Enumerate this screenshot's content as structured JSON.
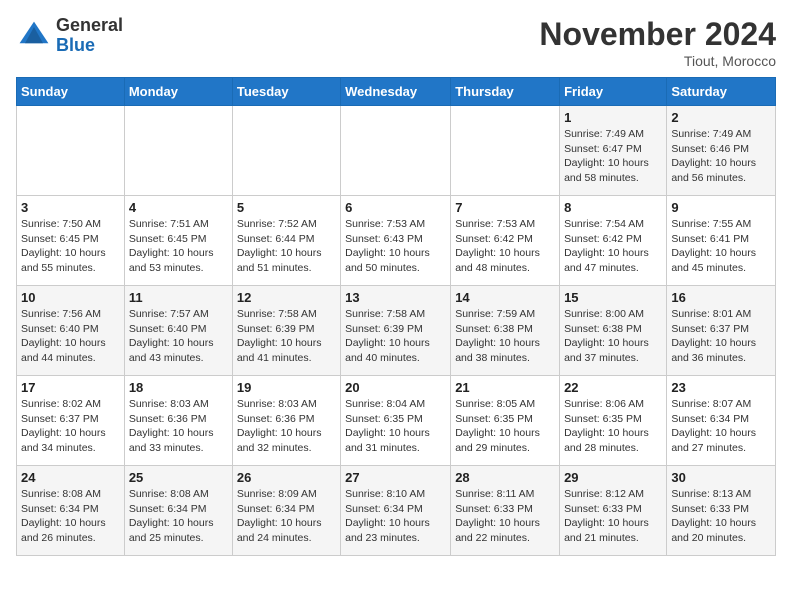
{
  "header": {
    "logo_general": "General",
    "logo_blue": "Blue",
    "month": "November 2024",
    "location": "Tiout, Morocco"
  },
  "days_of_week": [
    "Sunday",
    "Monday",
    "Tuesday",
    "Wednesday",
    "Thursday",
    "Friday",
    "Saturday"
  ],
  "weeks": [
    [
      {
        "day": "",
        "info": ""
      },
      {
        "day": "",
        "info": ""
      },
      {
        "day": "",
        "info": ""
      },
      {
        "day": "",
        "info": ""
      },
      {
        "day": "",
        "info": ""
      },
      {
        "day": "1",
        "info": "Sunrise: 7:49 AM\nSunset: 6:47 PM\nDaylight: 10 hours and 58 minutes."
      },
      {
        "day": "2",
        "info": "Sunrise: 7:49 AM\nSunset: 6:46 PM\nDaylight: 10 hours and 56 minutes."
      }
    ],
    [
      {
        "day": "3",
        "info": "Sunrise: 7:50 AM\nSunset: 6:45 PM\nDaylight: 10 hours and 55 minutes."
      },
      {
        "day": "4",
        "info": "Sunrise: 7:51 AM\nSunset: 6:45 PM\nDaylight: 10 hours and 53 minutes."
      },
      {
        "day": "5",
        "info": "Sunrise: 7:52 AM\nSunset: 6:44 PM\nDaylight: 10 hours and 51 minutes."
      },
      {
        "day": "6",
        "info": "Sunrise: 7:53 AM\nSunset: 6:43 PM\nDaylight: 10 hours and 50 minutes."
      },
      {
        "day": "7",
        "info": "Sunrise: 7:53 AM\nSunset: 6:42 PM\nDaylight: 10 hours and 48 minutes."
      },
      {
        "day": "8",
        "info": "Sunrise: 7:54 AM\nSunset: 6:42 PM\nDaylight: 10 hours and 47 minutes."
      },
      {
        "day": "9",
        "info": "Sunrise: 7:55 AM\nSunset: 6:41 PM\nDaylight: 10 hours and 45 minutes."
      }
    ],
    [
      {
        "day": "10",
        "info": "Sunrise: 7:56 AM\nSunset: 6:40 PM\nDaylight: 10 hours and 44 minutes."
      },
      {
        "day": "11",
        "info": "Sunrise: 7:57 AM\nSunset: 6:40 PM\nDaylight: 10 hours and 43 minutes."
      },
      {
        "day": "12",
        "info": "Sunrise: 7:58 AM\nSunset: 6:39 PM\nDaylight: 10 hours and 41 minutes."
      },
      {
        "day": "13",
        "info": "Sunrise: 7:58 AM\nSunset: 6:39 PM\nDaylight: 10 hours and 40 minutes."
      },
      {
        "day": "14",
        "info": "Sunrise: 7:59 AM\nSunset: 6:38 PM\nDaylight: 10 hours and 38 minutes."
      },
      {
        "day": "15",
        "info": "Sunrise: 8:00 AM\nSunset: 6:38 PM\nDaylight: 10 hours and 37 minutes."
      },
      {
        "day": "16",
        "info": "Sunrise: 8:01 AM\nSunset: 6:37 PM\nDaylight: 10 hours and 36 minutes."
      }
    ],
    [
      {
        "day": "17",
        "info": "Sunrise: 8:02 AM\nSunset: 6:37 PM\nDaylight: 10 hours and 34 minutes."
      },
      {
        "day": "18",
        "info": "Sunrise: 8:03 AM\nSunset: 6:36 PM\nDaylight: 10 hours and 33 minutes."
      },
      {
        "day": "19",
        "info": "Sunrise: 8:03 AM\nSunset: 6:36 PM\nDaylight: 10 hours and 32 minutes."
      },
      {
        "day": "20",
        "info": "Sunrise: 8:04 AM\nSunset: 6:35 PM\nDaylight: 10 hours and 31 minutes."
      },
      {
        "day": "21",
        "info": "Sunrise: 8:05 AM\nSunset: 6:35 PM\nDaylight: 10 hours and 29 minutes."
      },
      {
        "day": "22",
        "info": "Sunrise: 8:06 AM\nSunset: 6:35 PM\nDaylight: 10 hours and 28 minutes."
      },
      {
        "day": "23",
        "info": "Sunrise: 8:07 AM\nSunset: 6:34 PM\nDaylight: 10 hours and 27 minutes."
      }
    ],
    [
      {
        "day": "24",
        "info": "Sunrise: 8:08 AM\nSunset: 6:34 PM\nDaylight: 10 hours and 26 minutes."
      },
      {
        "day": "25",
        "info": "Sunrise: 8:08 AM\nSunset: 6:34 PM\nDaylight: 10 hours and 25 minutes."
      },
      {
        "day": "26",
        "info": "Sunrise: 8:09 AM\nSunset: 6:34 PM\nDaylight: 10 hours and 24 minutes."
      },
      {
        "day": "27",
        "info": "Sunrise: 8:10 AM\nSunset: 6:34 PM\nDaylight: 10 hours and 23 minutes."
      },
      {
        "day": "28",
        "info": "Sunrise: 8:11 AM\nSunset: 6:33 PM\nDaylight: 10 hours and 22 minutes."
      },
      {
        "day": "29",
        "info": "Sunrise: 8:12 AM\nSunset: 6:33 PM\nDaylight: 10 hours and 21 minutes."
      },
      {
        "day": "30",
        "info": "Sunrise: 8:13 AM\nSunset: 6:33 PM\nDaylight: 10 hours and 20 minutes."
      }
    ]
  ]
}
